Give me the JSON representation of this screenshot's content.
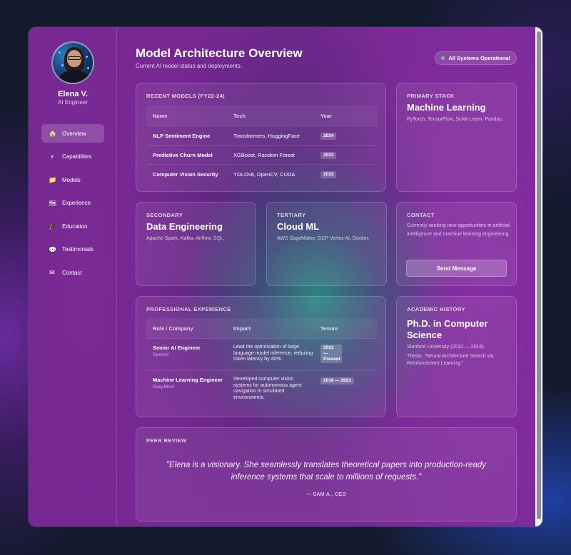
{
  "profile": {
    "name": "Elena V.",
    "role": "AI Engineer"
  },
  "nav": [
    {
      "label": "Overview",
      "icon": "🏠",
      "active": true
    },
    {
      "label": "Capabilities",
      "icon": "⚡"
    },
    {
      "label": "Models",
      "icon": "📁"
    },
    {
      "label": "Experience",
      "icon": "🗺"
    },
    {
      "label": "Education",
      "icon": "🎓"
    },
    {
      "label": "Testimonials",
      "icon": "💬"
    },
    {
      "label": "Contact",
      "icon": "✉"
    }
  ],
  "header": {
    "title": "Model Architecture Overview",
    "subtitle": "Current AI model status and deployments.",
    "status": "All Systems Operational",
    "status_color": "#4ade80"
  },
  "recent_models": {
    "label": "RECENT MODELS (FY22-24)",
    "columns": [
      "Name",
      "Tech",
      "Year"
    ],
    "rows": [
      {
        "name": "NLP Sentiment Engine",
        "tech": "Transformers, HuggingFace",
        "year": "2024"
      },
      {
        "name": "Predictive Churn Model",
        "tech": "XGBoost, Random Forest",
        "year": "2023"
      },
      {
        "name": "Computer Vision Security",
        "tech": "YOLOv8, OpenCV, CUDA",
        "year": "2022"
      }
    ]
  },
  "primary_stack": {
    "label": "PRIMARY STACK",
    "heading": "Machine Learning",
    "text": "PyTorch, TensorFlow, Scikit-Learn, Pandas."
  },
  "secondary": {
    "label": "SECONDARY",
    "heading": "Data Engineering",
    "text": "Apache Spark, Kafka, Airflow, SQL."
  },
  "tertiary": {
    "label": "TERTIARY",
    "heading": "Cloud ML",
    "text": "AWS SageMaker, GCP Vertex AI, Docker."
  },
  "contact": {
    "label": "CONTACT",
    "text": "Currently seeking new opportunities in artificial intelligence and machine learning engineering.",
    "button": "Send Message"
  },
  "experience": {
    "label": "PROFESSIONAL EXPERIENCE",
    "columns": [
      "Role / Company",
      "Impact",
      "Tenure"
    ],
    "rows": [
      {
        "role": "Senior AI Engineer",
        "company": "OpenAI",
        "impact": "Lead the optimization of large language model inference, reducing token latency by 40%.",
        "tenure": "2021 — Present"
      },
      {
        "role": "Machine Learning Engineer",
        "company": "DeepMind",
        "impact": "Developed computer vision systems for autonomous agent navigation in simulated environments.",
        "tenure": "2016 — 2021"
      }
    ]
  },
  "academic": {
    "label": "ACADEMIC HISTORY",
    "heading": "Ph.D. in Computer Science",
    "school": "Stanford University (2012 — 2016).",
    "thesis": "Thesis: \"Neural Architecture Search via Reinforcement Learning.\""
  },
  "peer_review": {
    "label": "PEER REVIEW",
    "quote": "\"Elena is a visionary. She seamlessly translates theoretical papers into production-ready inference systems that scale to millions of requests.\"",
    "author": "— SAM A., CEO"
  }
}
